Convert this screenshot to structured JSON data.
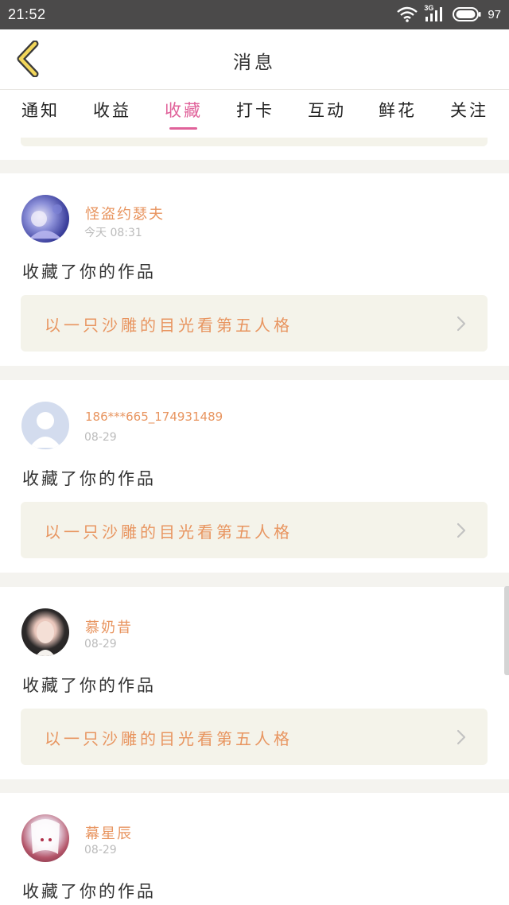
{
  "status_bar": {
    "time": "21:52",
    "network": "3G",
    "battery": "97"
  },
  "header": {
    "title": "消息",
    "back_icon": "chevron-left-icon"
  },
  "tabs": [
    {
      "label": "通知",
      "active": false
    },
    {
      "label": "收益",
      "active": false
    },
    {
      "label": "收藏",
      "active": true
    },
    {
      "label": "打卡",
      "active": false
    },
    {
      "label": "互动",
      "active": false
    },
    {
      "label": "鲜花",
      "active": false
    },
    {
      "label": "关注",
      "active": false
    }
  ],
  "colors": {
    "accent": "#e0629a",
    "name": "#e89560",
    "link_bg": "#f4f3ea",
    "page_bg": "#f4f3ef"
  },
  "messages": [
    {
      "user": "怪盗约瑟夫",
      "time": "今天 08:31",
      "action": "收藏了你的作品",
      "work": "以一只沙雕的目光看第五人格"
    },
    {
      "user": "186***665_174931489",
      "time": "08-29",
      "action": "收藏了你的作品",
      "work": "以一只沙雕的目光看第五人格"
    },
    {
      "user": "慕奶昔",
      "time": "08-29",
      "action": "收藏了你的作品",
      "work": "以一只沙雕的目光看第五人格"
    },
    {
      "user": "幕星辰",
      "time": "08-29",
      "action": "收藏了你的作品"
    }
  ]
}
